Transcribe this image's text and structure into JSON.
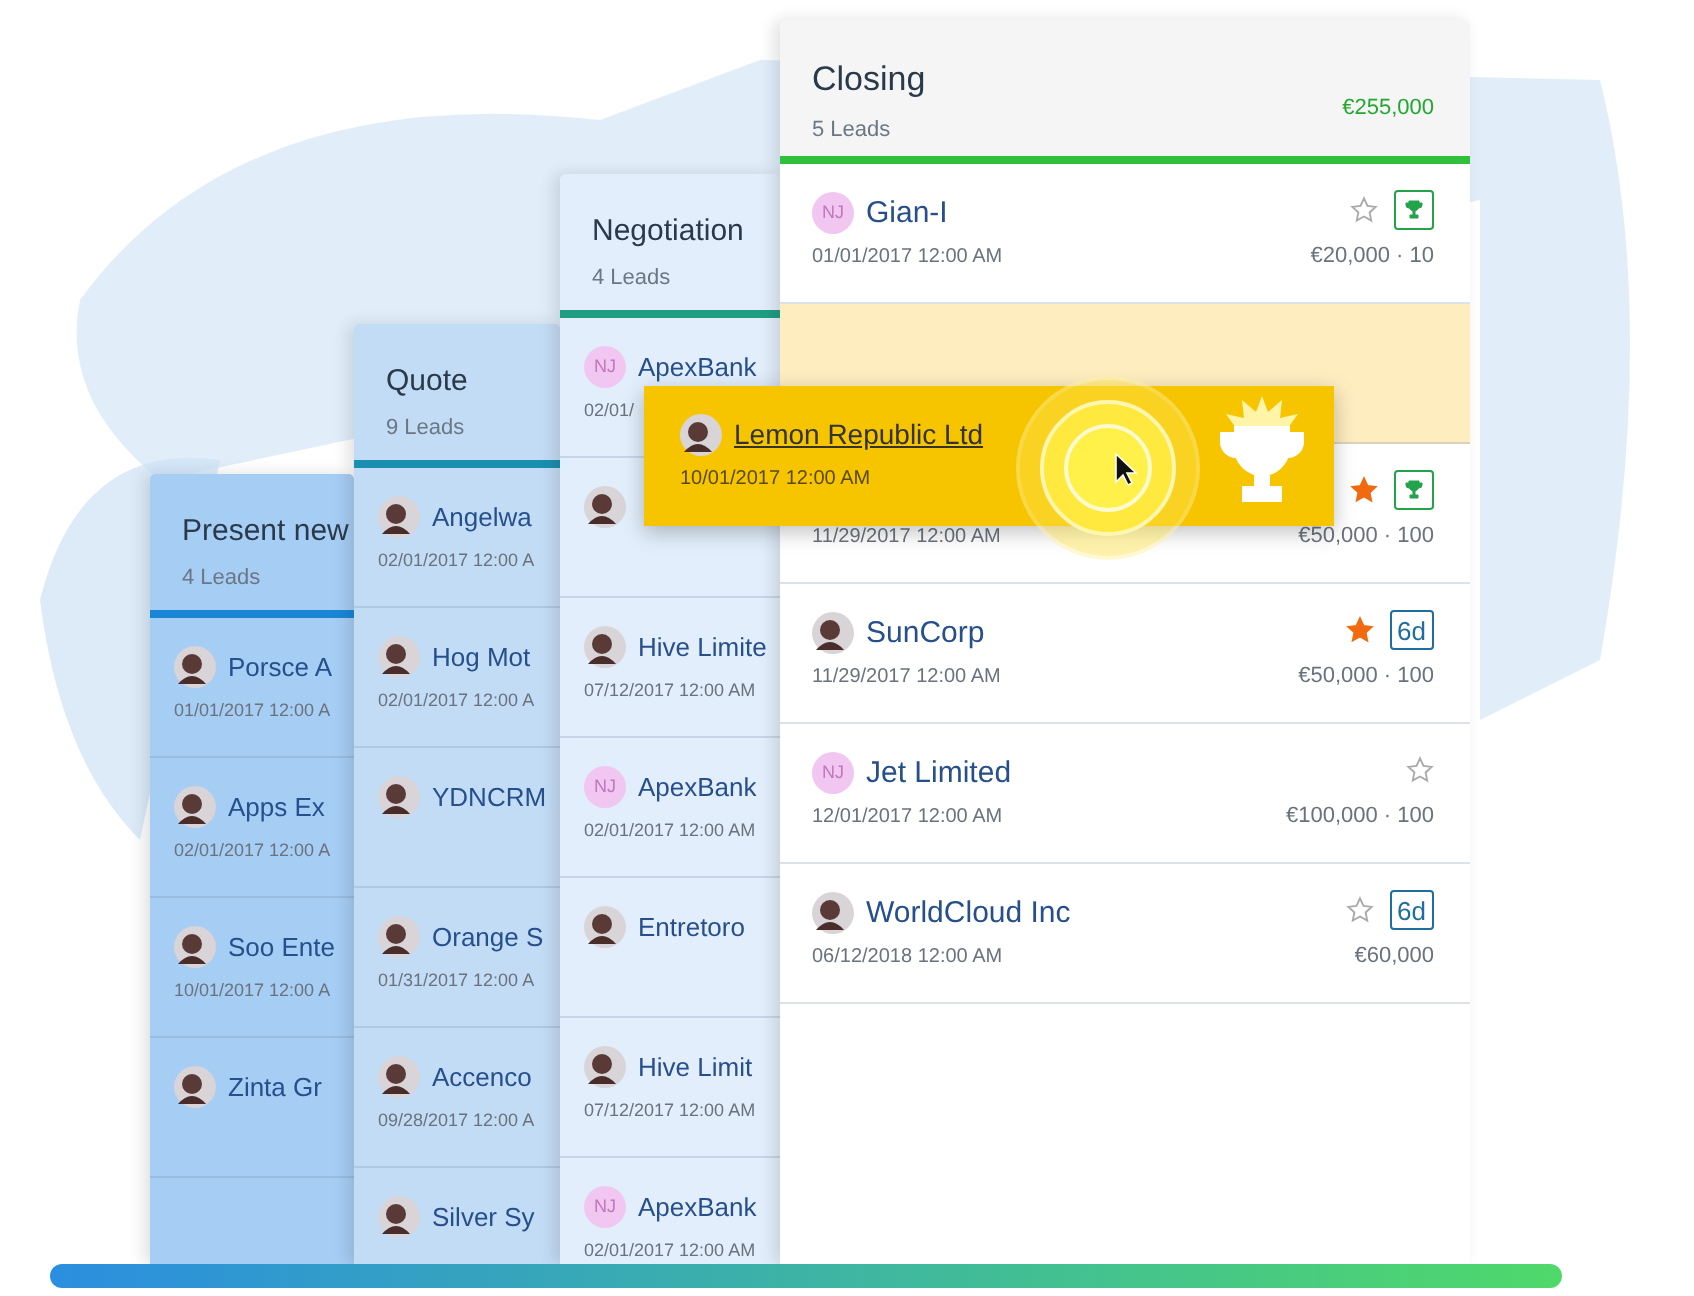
{
  "columns": [
    {
      "title": "Present new",
      "count": "4 Leads",
      "color": "#1a87d6",
      "kind": "deep",
      "cards": [
        {
          "name": "Porsce A",
          "date": "01/01/2017 12:00 A",
          "kind": "photo"
        },
        {
          "name": "Apps Ex",
          "date": "02/01/2017 12:00 A",
          "kind": "photo"
        },
        {
          "name": "Soo Ente",
          "date": "10/01/2017 12:00 A",
          "kind": "photo"
        },
        {
          "name": "Zinta Gr",
          "kind": "photo"
        }
      ]
    },
    {
      "title": "Quote",
      "count": "9 Leads",
      "color": "#1a8fb0",
      "kind": "mid",
      "cards": [
        {
          "name": "Angelwa",
          "date": "02/01/2017 12:00 A",
          "kind": "photo"
        },
        {
          "name": "Hog Mot",
          "date": "02/01/2017 12:00 A",
          "kind": "photo"
        },
        {
          "name": "YDNCRM",
          "kind": "photo"
        },
        {
          "name": "Orange S",
          "date": "01/31/2017 12:00 A",
          "kind": "photo"
        },
        {
          "name": "Accenco",
          "date": "09/28/2017 12:00 A",
          "kind": "photo"
        },
        {
          "name": "Silver Sy",
          "kind": "photo"
        }
      ]
    },
    {
      "title": "Negotiation",
      "count": "4 Leads",
      "color": "#1f9e84",
      "kind": "light",
      "cards": [
        {
          "name": "ApexBank",
          "date": "02/01/",
          "kind": "initials",
          "initials": "NJ"
        },
        {
          "kind": "photo"
        },
        {
          "name": "Hive Limite",
          "date": "07/12/2017 12:00 AM",
          "kind": "photo"
        },
        {
          "name": "ApexBank",
          "date": "02/01/2017 12:00 AM",
          "kind": "initials",
          "initials": "NJ"
        },
        {
          "name": "Entretoro",
          "kind": "photo"
        },
        {
          "name": "Hive Limit",
          "date": "07/12/2017 12:00 AM",
          "kind": "photo"
        },
        {
          "name": "ApexBank",
          "date": "02/01/2017 12:00 AM",
          "kind": "initials",
          "initials": "NJ"
        }
      ]
    },
    {
      "title": "Closing",
      "count": "5 Leads",
      "total": "€255,000",
      "color": "#2fc03c",
      "kind": "white",
      "cards": [
        {
          "name": "Gian-I",
          "date": "01/01/2017 12:00 AM",
          "kind": "initials",
          "initials": "NJ",
          "starred": false,
          "badge": {
            "kind": "trophy"
          },
          "amount": "€20,000 · 10"
        },
        {
          "kind": "drop-slot"
        },
        {
          "date": "11/29/2017 12:00 AM",
          "starred": true,
          "badge": {
            "kind": "trophy"
          },
          "amount": "€50,000 · 100"
        },
        {
          "name": "SunCorp",
          "date": "11/29/2017 12:00 AM",
          "kind": "photo",
          "starred": true,
          "badge": {
            "kind": "days",
            "text": "6d"
          },
          "amount": "€50,000 · 100"
        },
        {
          "name": "Jet Limited",
          "date": "12/01/2017 12:00 AM",
          "kind": "initials",
          "initials": "NJ",
          "starred": false,
          "amount": "€100,000 · 100"
        },
        {
          "name": "WorldCloud Inc",
          "date": "06/12/2018 12:00 AM",
          "kind": "photo",
          "starred": false,
          "badge": {
            "kind": "days",
            "text": "6d"
          },
          "amount": "€60,000"
        }
      ]
    }
  ],
  "dragged_card": {
    "name": "Lemon Republic Ltd",
    "date": "10/01/2017 12:00 AM",
    "kind": "photo"
  }
}
